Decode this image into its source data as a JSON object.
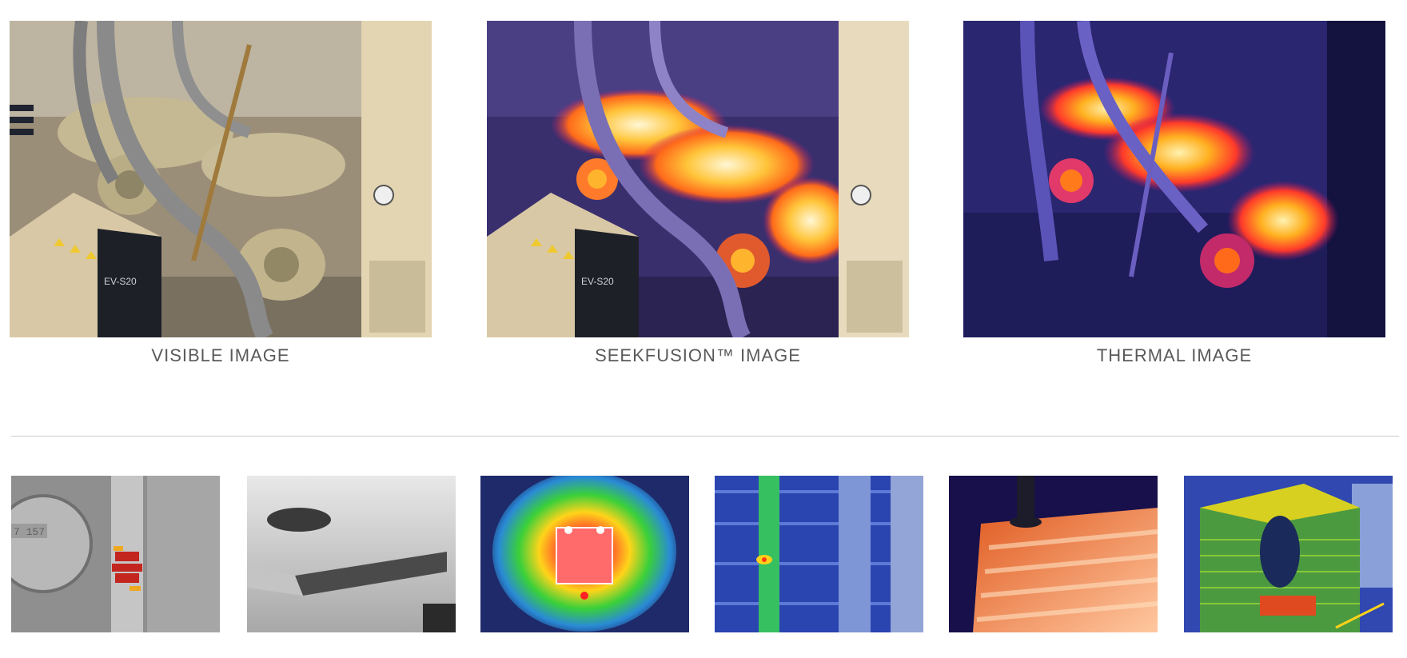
{
  "gallery": {
    "featured": [
      {
        "caption": "VISIBLE IMAGE",
        "subject": "industrial vacuum pumps and hoses, visible light photo",
        "device_label": "EV-S20"
      },
      {
        "caption": "SEEKFUSION™ IMAGE",
        "subject": "industrial vacuum pumps with thermal overlay",
        "device_label": "EV-S20"
      },
      {
        "caption": "THERMAL IMAGE",
        "subject": "industrial vacuum pumps, thermal only"
      }
    ],
    "thumbnails": [
      {
        "subject": "electric meter and breaker panel, thermal hotspots",
        "readout": "7 157"
      },
      {
        "subject": "ceiling vent, grayscale thermal"
      },
      {
        "subject": "wall outlet, rainbow thermal"
      },
      {
        "subject": "warehouse pipes and racks, thermal"
      },
      {
        "subject": "radiant floor heating, thermal"
      },
      {
        "subject": "outdoor AC condenser unit, thermal"
      }
    ]
  }
}
